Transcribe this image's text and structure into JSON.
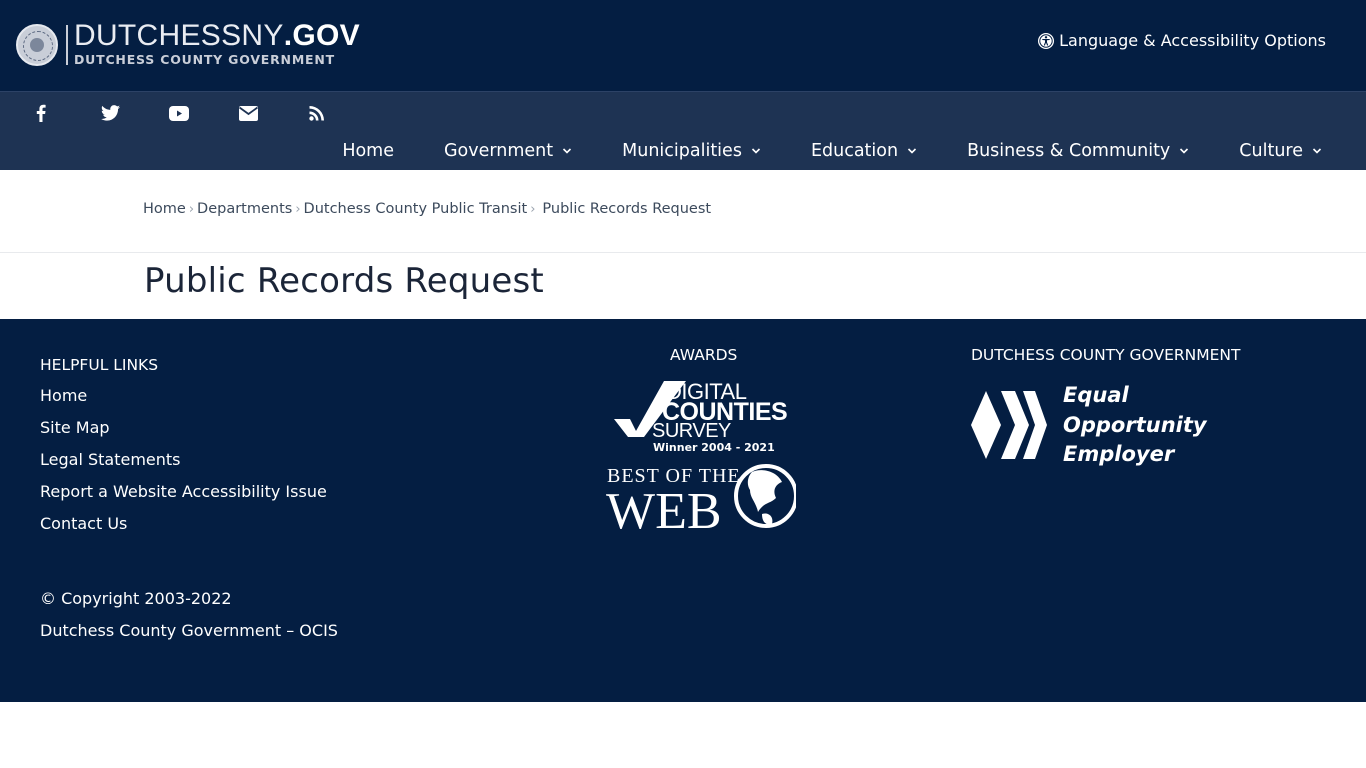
{
  "header": {
    "logo_main": "DUTCHESSNY",
    "logo_tld": ".GOV",
    "logo_sub": "DUTCHESS COUNTY GOVERNMENT",
    "language_button": "Language & Accessibility Options",
    "language_icon": "universal-access-icon"
  },
  "social": [
    {
      "name": "facebook",
      "icon": "facebook-icon"
    },
    {
      "name": "twitter",
      "icon": "twitter-icon"
    },
    {
      "name": "youtube",
      "icon": "youtube-icon"
    },
    {
      "name": "email",
      "icon": "envelope-icon"
    },
    {
      "name": "rss",
      "icon": "rss-icon"
    }
  ],
  "nav": {
    "items": [
      {
        "label": "Home",
        "dropdown": false
      },
      {
        "label": "Government",
        "dropdown": true
      },
      {
        "label": "Municipalities",
        "dropdown": true
      },
      {
        "label": "Education",
        "dropdown": true
      },
      {
        "label": "Business & Community",
        "dropdown": true
      },
      {
        "label": "Culture",
        "dropdown": true
      }
    ]
  },
  "breadcrumb": {
    "items": [
      "Home",
      "Departments",
      "Dutchess County Public Transit"
    ],
    "current": "Public Records Request",
    "separator": "›"
  },
  "page": {
    "title": "Public Records Request"
  },
  "footer": {
    "helpful_links_heading": "HELPFUL LINKS",
    "helpful_links": [
      "Home",
      "Site Map",
      "Legal Statements",
      "Report a Website Accessibility Issue",
      "Contact Us"
    ],
    "copyright": "© Copyright 2003-2022",
    "org_line": "Dutchess County Government – OCIS",
    "awards_heading": "AWARDS",
    "awards": {
      "digital_counties": {
        "line1": "DIGITAL",
        "line2": "COUNTIES",
        "line3": "SURVEY",
        "line4": "Winner 2004 - 2021"
      },
      "best_of_web": {
        "line1": "BEST OF THE",
        "line2": "WEB"
      }
    },
    "gov_heading": "DUTCHESS COUNTY GOVERNMENT",
    "eoe": {
      "line1": "Equal",
      "line2": "Opportunity",
      "line3": "Employer"
    }
  },
  "colors": {
    "header_bg": "#041e42",
    "nav_bg": "#1e3353",
    "footer_bg": "#041e42",
    "title_text": "#1b2538"
  }
}
